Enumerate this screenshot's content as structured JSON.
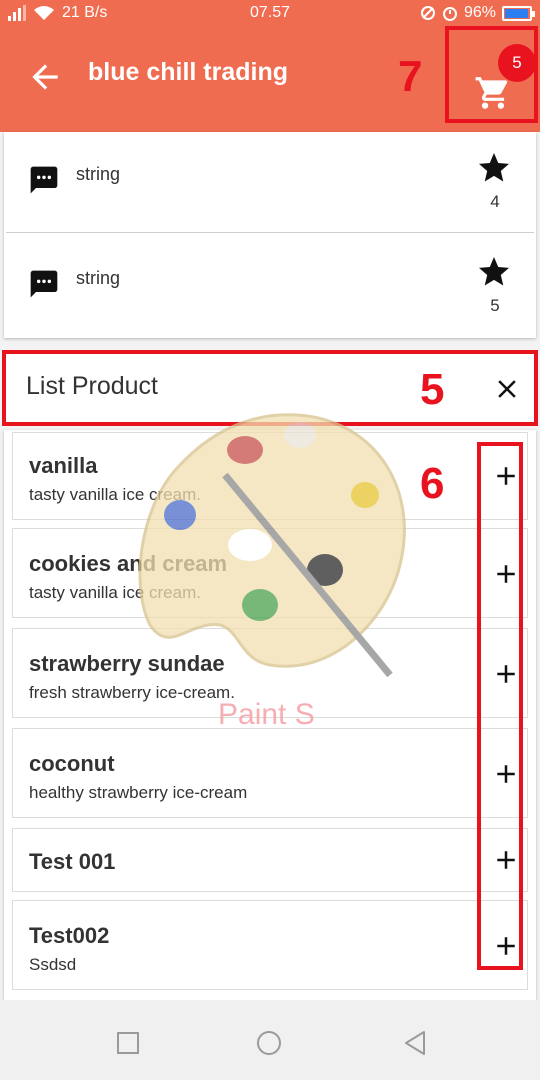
{
  "status_bar": {
    "left": "21 B/s",
    "time": "07.57",
    "battery": "96%",
    "battery_level": 0.96
  },
  "app_bar": {
    "title": "blue chill trading",
    "back_icon": "arrow-back-icon",
    "cart_icon": "shopping-cart-icon",
    "cart_count": "5",
    "annotation_cart": "7"
  },
  "comments": [
    {
      "text": "string",
      "rating": "4",
      "icon": "message-icon"
    },
    {
      "text": "string",
      "rating": "5",
      "icon": "message-icon"
    }
  ],
  "list_product": {
    "title": "List Product",
    "annotation_header": "5",
    "annotation_add": "6",
    "close_icon": "close-icon"
  },
  "products": [
    {
      "name": "vanilla",
      "description": "tasty vanilla ice cream."
    },
    {
      "name": "cookies and cream",
      "description": "tasty vanilla ice cream."
    },
    {
      "name": "strawberry sundae",
      "description": "fresh strawberry ice-cream."
    },
    {
      "name": "coconut",
      "description": "healthy strawberry ice-cream"
    },
    {
      "name": "Test 001",
      "description": ""
    },
    {
      "name": "Test002",
      "description": "Ssdsd"
    }
  ],
  "watermark": {
    "text": "Paint S"
  },
  "colors": {
    "app_bar": "#ef6c50",
    "annotation_red": "#e8131f",
    "battery_fill": "#2b7ff0"
  }
}
